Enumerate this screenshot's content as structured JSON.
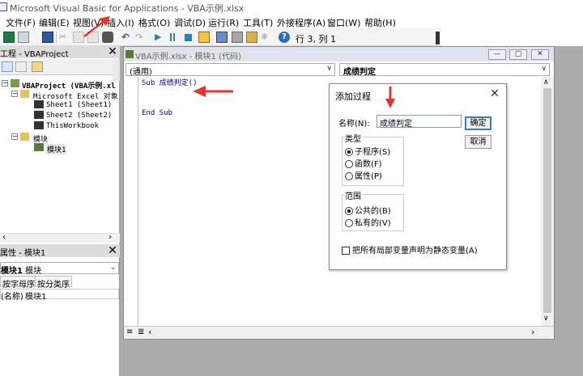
{
  "window": {
    "title": "Microsoft Visual Basic for Applications - VBA示例.xlsx"
  },
  "menu": [
    "文件(F)",
    "编辑(E)",
    "视图(V)",
    "插入(I)",
    "格式(O)",
    "调试(D)",
    "运行(R)",
    "工具(T)",
    "外接程序(A)",
    "窗口(W)",
    "帮助(H)"
  ],
  "toolbar": {
    "position": "行 3, 列 1"
  },
  "project": {
    "header": "工程 - VBAProject",
    "tree": [
      "VBAProject (VBA示例.xl",
      "Microsoft Excel 对象",
      "Sheet1 (Sheet1)",
      "Sheet2 (Sheet2)",
      "ThisWorkbook",
      "模块",
      "模块1"
    ]
  },
  "properties": {
    "header": "属性 - 模块1",
    "object_name": "模块1",
    "object_type": "模块",
    "tab_alpha": "按字母序",
    "tab_category": "按分类序",
    "row_name": "(名称)",
    "row_value": "模块1"
  },
  "code_window": {
    "title": "VBA示例.xlsx - 模块1 (代码)",
    "object_combo": "(通用)",
    "proc_combo": "成绩判定",
    "lines": [
      "Sub 成绩判定()",
      "End Sub"
    ]
  },
  "dialog": {
    "title": "添加过程",
    "name_label": "名称(N):",
    "name_value": "成绩判定",
    "ok": "确定",
    "cancel": "取消",
    "type_label": "类型",
    "type_options": [
      "子程序(S)",
      "函数(F)",
      "属性(P)"
    ],
    "scope_label": "范围",
    "scope_options": [
      "公共的(B)",
      "私有的(V)"
    ],
    "static_label": "把所有局部变量声明为静态变量(A)"
  },
  "colors": {
    "annotation_arrow": "#e8342a",
    "code_keyword": "#00008b"
  }
}
